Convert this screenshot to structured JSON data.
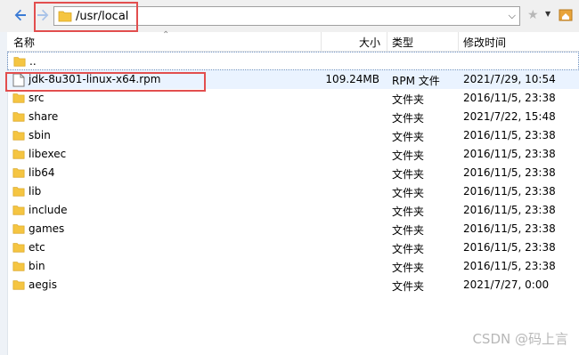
{
  "address": {
    "path": "/usr/local"
  },
  "columns": {
    "name": "名称",
    "size": "大小",
    "type": "类型",
    "modified": "修改时间"
  },
  "rows": [
    {
      "name": "..",
      "size": "",
      "type": "",
      "modified": "",
      "icon": "folder-icon"
    },
    {
      "name": "jdk-8u301-linux-x64.rpm",
      "size": "109.24MB",
      "type": "RPM 文件",
      "modified": "2021/7/29, 10:54",
      "icon": "file-icon"
    },
    {
      "name": "src",
      "size": "",
      "type": "文件夹",
      "modified": "2016/11/5, 23:38",
      "icon": "folder-icon"
    },
    {
      "name": "share",
      "size": "",
      "type": "文件夹",
      "modified": "2021/7/22, 15:48",
      "icon": "folder-icon"
    },
    {
      "name": "sbin",
      "size": "",
      "type": "文件夹",
      "modified": "2016/11/5, 23:38",
      "icon": "folder-icon"
    },
    {
      "name": "libexec",
      "size": "",
      "type": "文件夹",
      "modified": "2016/11/5, 23:38",
      "icon": "folder-icon"
    },
    {
      "name": "lib64",
      "size": "",
      "type": "文件夹",
      "modified": "2016/11/5, 23:38",
      "icon": "folder-icon"
    },
    {
      "name": "lib",
      "size": "",
      "type": "文件夹",
      "modified": "2016/11/5, 23:38",
      "icon": "folder-icon"
    },
    {
      "name": "include",
      "size": "",
      "type": "文件夹",
      "modified": "2016/11/5, 23:38",
      "icon": "folder-icon"
    },
    {
      "name": "games",
      "size": "",
      "type": "文件夹",
      "modified": "2016/11/5, 23:38",
      "icon": "folder-icon"
    },
    {
      "name": "etc",
      "size": "",
      "type": "文件夹",
      "modified": "2016/11/5, 23:38",
      "icon": "folder-icon"
    },
    {
      "name": "bin",
      "size": "",
      "type": "文件夹",
      "modified": "2016/11/5, 23:38",
      "icon": "folder-icon"
    },
    {
      "name": "aegis",
      "size": "",
      "type": "文件夹",
      "modified": "2021/7/27, 0:00",
      "icon": "folder-icon"
    }
  ],
  "watermark": "CSDN @码上言",
  "colors": {
    "highlight": "#e24e4e",
    "folder": "#f5c542",
    "selected_row": "#eaf3ff"
  }
}
